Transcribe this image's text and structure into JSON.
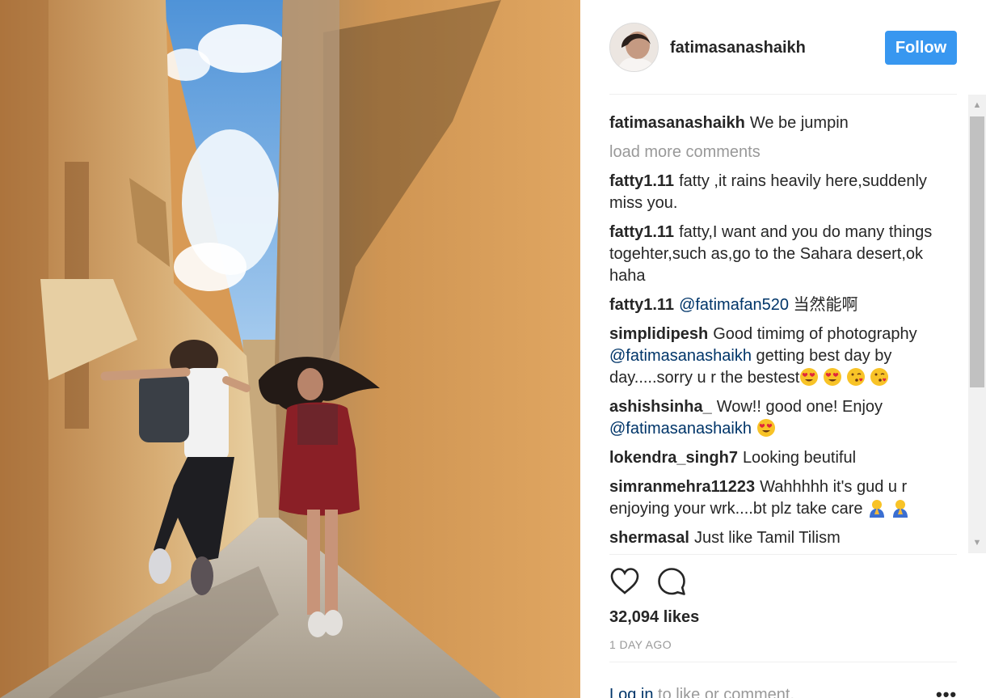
{
  "post": {
    "author": "fatimasanashaikh",
    "follow_label": "Follow",
    "caption": "We be jumpin",
    "load_more": "load more comments",
    "likes": "32,094 likes",
    "time": "1 DAY AGO",
    "login_link": "Log in",
    "login_rest": " to like or comment."
  },
  "comments": [
    {
      "user": "fatty1.11",
      "text": "fatty ,it rains heavily here,suddenly miss you."
    },
    {
      "user": "fatty1.11",
      "text": "fatty,I want and you do many things togehter,such as,go to the Sahara desert,ok haha"
    },
    {
      "user": "fatty1.11",
      "mention": "@fatimafan520",
      "text": " 当然能啊"
    },
    {
      "user": "simplidipesh",
      "text": "Good timimg of photography ",
      "mention": "@fatimasanashaikh",
      "text2": " getting best day by day.....sorry u r the bestest",
      "emojis": [
        "heart-eyes-emoji",
        "heart-eyes-emoji",
        "kiss-emoji",
        "kiss-emoji"
      ]
    },
    {
      "user": "ashishsinha_",
      "text": "Wow!! good one! Enjoy ",
      "mention": "@fatimasanashaikh",
      "text2": " ",
      "emojis": [
        "heart-eyes-emoji"
      ]
    },
    {
      "user": "lokendra_singh7",
      "text": "Looking beutiful"
    },
    {
      "user": "simranmehra11223",
      "text": "Wahhhhh it's gud u r enjoying your wrk....bt plz take care",
      "emojis": [
        "pray-emoji",
        "pray-emoji"
      ]
    },
    {
      "user": "shermasal",
      "text": "Just like Tamil Tilism"
    }
  ],
  "icons": {
    "like": "heart-icon",
    "comment": "comment-bubble-icon",
    "more": "more-options-icon"
  },
  "colors": {
    "follow_bg": "#3897f0",
    "mention": "#003569",
    "muted": "#999999"
  }
}
